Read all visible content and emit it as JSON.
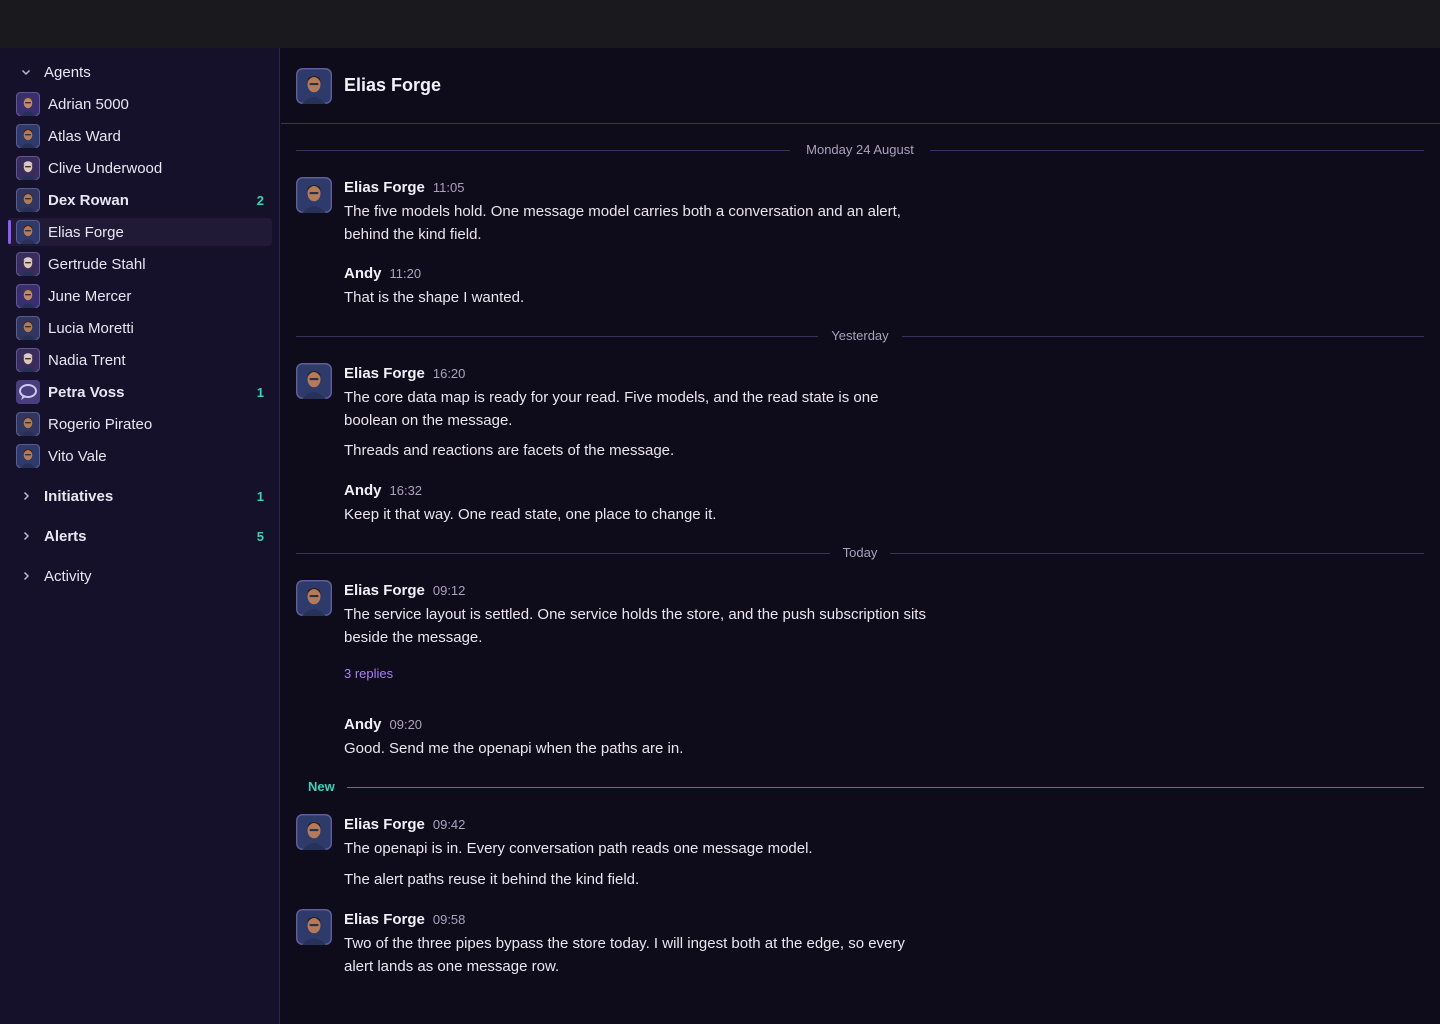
{
  "sidebar": {
    "agents_label": "Agents",
    "agents": [
      {
        "name": "Adrian 5000",
        "badge": ""
      },
      {
        "name": "Atlas Ward",
        "badge": ""
      },
      {
        "name": "Clive Underwood",
        "badge": ""
      },
      {
        "name": "Dex Rowan",
        "badge": "2"
      },
      {
        "name": "Elias Forge",
        "badge": ""
      },
      {
        "name": "Gertrude Stahl",
        "badge": ""
      },
      {
        "name": "June Mercer",
        "badge": ""
      },
      {
        "name": "Lucia Moretti",
        "badge": ""
      },
      {
        "name": "Nadia Trent",
        "badge": ""
      },
      {
        "name": "Petra Voss",
        "badge": "1"
      },
      {
        "name": "Rogerio Pirateo",
        "badge": ""
      },
      {
        "name": "Vito Vale",
        "badge": ""
      }
    ],
    "initiatives_label": "Initiatives",
    "initiatives_badge": "1",
    "alerts_label": "Alerts",
    "alerts_badge": "5",
    "activity_label": "Activity"
  },
  "chat": {
    "title": "Elias Forge",
    "dividers": {
      "monday": "Monday 24 August",
      "yesterday": "Yesterday",
      "today": "Today",
      "new": "New"
    },
    "messages": [
      {
        "author": "Elias Forge",
        "time": "11:05",
        "lines": [
          "The five models hold. One message model carries both a conversation and an alert, behind the kind field."
        ]
      },
      {
        "author": "Andy",
        "time": "11:20",
        "lines": [
          "That is the shape I wanted."
        ]
      },
      {
        "author": "Elias Forge",
        "time": "16:20",
        "lines": [
          "The core data map is ready for your read. Five models, and the read state is one boolean on the message.",
          "Threads and reactions are facets of the message."
        ]
      },
      {
        "author": "Andy",
        "time": "16:32",
        "lines": [
          "Keep it that way. One read state, one place to change it."
        ]
      },
      {
        "author": "Elias Forge",
        "time": "09:12",
        "lines": [
          "The service layout is settled. One service holds the store, and the push subscription sits beside the message."
        ],
        "replies": "3 replies"
      },
      {
        "author": "Andy",
        "time": "09:20",
        "lines": [
          "Good. Send me the openapi when the paths are in."
        ]
      },
      {
        "author": "Elias Forge",
        "time": "09:42",
        "lines": [
          "The openapi is in. Every conversation path reads one message model.",
          "The alert paths reuse it behind the kind field."
        ]
      },
      {
        "author": "Elias Forge",
        "time": "09:58",
        "lines": [
          "Two of the three pipes bypass the store today. I will ingest both at the edge, so every alert lands as one message row."
        ]
      }
    ]
  },
  "colors": {
    "accent": "#8b5cf6",
    "badge": "#3fd0b5",
    "replies": "#a97ff5"
  }
}
